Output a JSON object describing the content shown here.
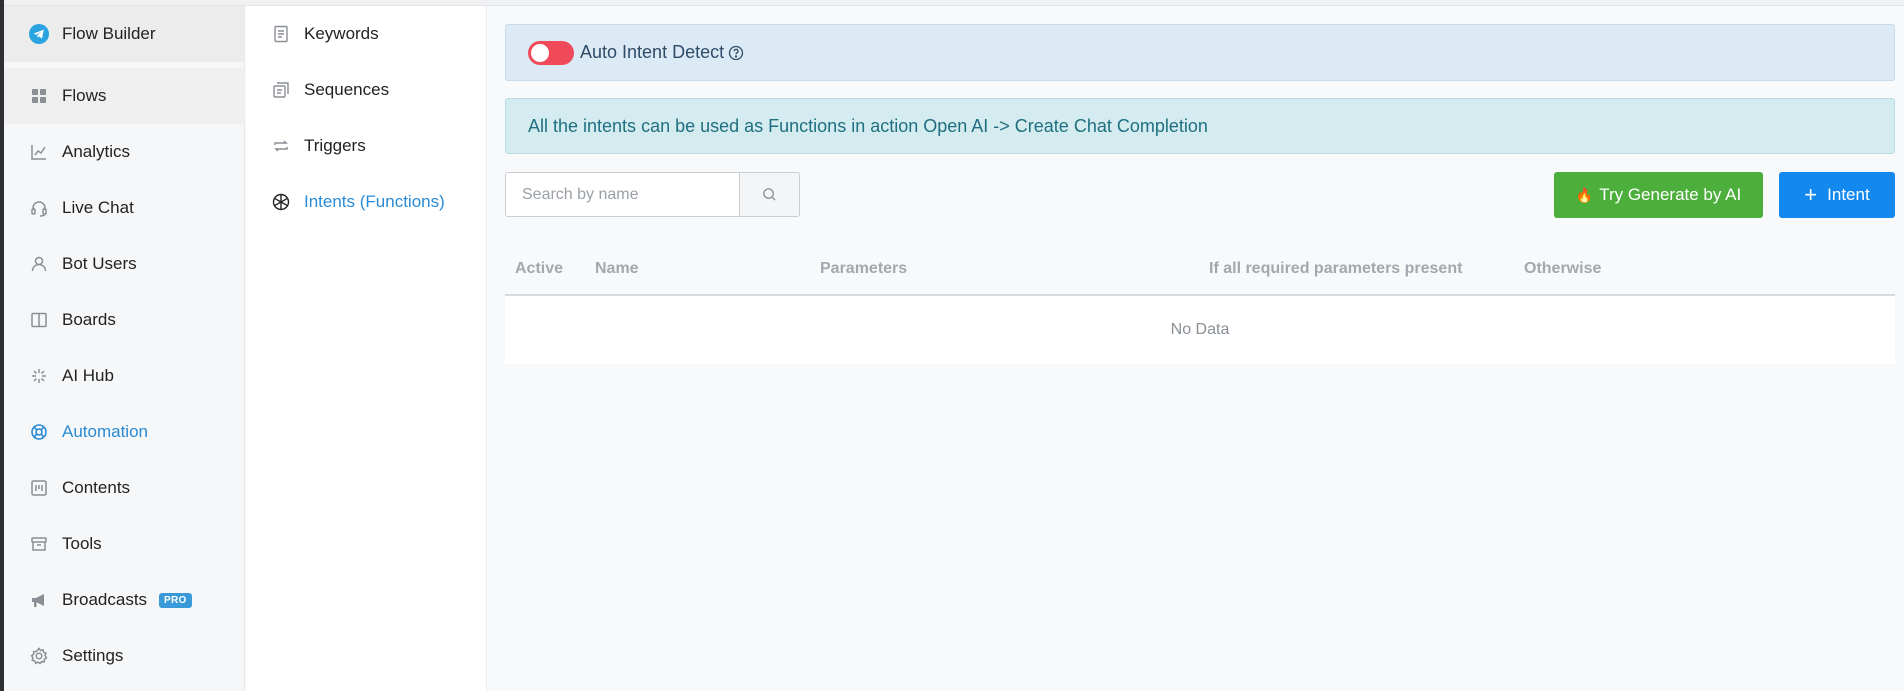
{
  "sidebar": {
    "header": {
      "label": "Flow Builder",
      "icon": "telegram-icon"
    },
    "items": [
      {
        "label": "Flows",
        "icon": "grid-icon"
      },
      {
        "label": "Analytics",
        "icon": "chart-icon"
      },
      {
        "label": "Live Chat",
        "icon": "headset-icon"
      },
      {
        "label": "Bot Users",
        "icon": "user-icon"
      },
      {
        "label": "Boards",
        "icon": "board-icon"
      },
      {
        "label": "AI Hub",
        "icon": "sparkle-icon"
      },
      {
        "label": "Automation",
        "icon": "lifebuoy-icon"
      },
      {
        "label": "Contents",
        "icon": "contents-icon"
      },
      {
        "label": "Tools",
        "icon": "archive-icon"
      },
      {
        "label": "Broadcasts",
        "icon": "megaphone-icon",
        "badge": "PRO"
      },
      {
        "label": "Settings",
        "icon": "gear-icon"
      }
    ]
  },
  "subnav": {
    "items": [
      {
        "label": "Keywords",
        "icon": "document-icon"
      },
      {
        "label": "Sequences",
        "icon": "sequences-icon"
      },
      {
        "label": "Triggers",
        "icon": "repeat-icon"
      },
      {
        "label": "Intents (Functions)",
        "icon": "openai-icon"
      }
    ]
  },
  "main": {
    "auto_intent": {
      "label": "Auto Intent Detect",
      "enabled": false
    },
    "info_text": "All the intents can be used as Functions in action Open AI -> Create Chat Completion",
    "search": {
      "placeholder": "Search by name",
      "value": ""
    },
    "ai_button": {
      "label": "Try Generate by AI",
      "emoji": "🔥"
    },
    "intent_button": {
      "label": "Intent"
    },
    "table": {
      "columns": [
        "Active",
        "Name",
        "Parameters",
        "If all required parameters present",
        "Otherwise"
      ],
      "empty_text": "No Data"
    }
  },
  "colors": {
    "accent": "#2a8bd6",
    "toggle_off": "#f04a5a",
    "ai_button": "#4caf3c",
    "intent_button": "#1388ef"
  }
}
